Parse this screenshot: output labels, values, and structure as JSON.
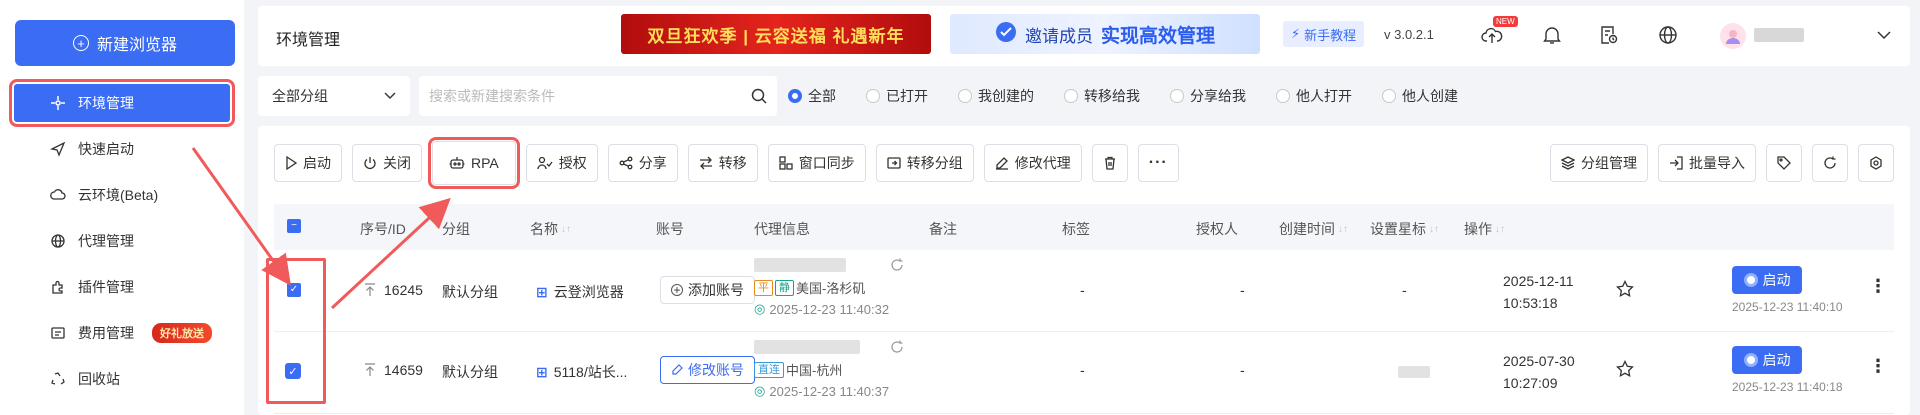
{
  "sidebar": {
    "new_button": "新建浏览器",
    "items": [
      {
        "label": "环境管理",
        "icon": "env-icon",
        "active": true
      },
      {
        "label": "快速启动",
        "icon": "send-icon"
      },
      {
        "label": "云环境(Beta)",
        "icon": "cloud-icon"
      },
      {
        "label": "代理管理",
        "icon": "globe-icon"
      },
      {
        "label": "插件管理",
        "icon": "plugin-icon"
      },
      {
        "label": "费用管理",
        "icon": "billing-icon",
        "badge": "好礼放送"
      },
      {
        "label": "回收站",
        "icon": "recycle-icon"
      }
    ]
  },
  "header": {
    "title": "环境管理",
    "banner1": "双旦狂欢季 | 云容送福 礼遇新年",
    "banner2_prefix": "邀请成员",
    "banner2_emphasis": "实现高效管理",
    "tutorial": "新手教程",
    "version": "v 3.0.2.1",
    "new_tag": "NEW"
  },
  "filters": {
    "group_select": "全部分组",
    "search_placeholder": "搜索或新建搜索条件",
    "radios": [
      "全部",
      "已打开",
      "我创建的",
      "转移给我",
      "分享给我",
      "他人打开",
      "他人创建"
    ],
    "selected_radio": 0
  },
  "toolbar": {
    "left": [
      {
        "label": "启动",
        "icon": "play-icon"
      },
      {
        "label": "关闭",
        "icon": "power-icon"
      },
      {
        "label": "RPA",
        "icon": "robot-icon"
      },
      {
        "label": "授权",
        "icon": "user-check-icon"
      },
      {
        "label": "分享",
        "icon": "share-icon"
      },
      {
        "label": "转移",
        "icon": "transfer-icon"
      },
      {
        "label": "窗口同步",
        "icon": "window-sync-icon"
      },
      {
        "label": "转移分组",
        "icon": "folder-move-icon"
      },
      {
        "label": "修改代理",
        "icon": "edit-icon"
      },
      {
        "label": "",
        "icon": "trash-icon"
      },
      {
        "label": "",
        "icon": "more-icon"
      }
    ],
    "right": [
      {
        "label": "分组管理",
        "icon": "layers-icon"
      },
      {
        "label": "批量导入",
        "icon": "import-icon"
      },
      {
        "label": "",
        "icon": "tag-icon"
      },
      {
        "label": "",
        "icon": "refresh-icon"
      },
      {
        "label": "",
        "icon": "settings-icon"
      }
    ]
  },
  "table": {
    "columns": {
      "id": "序号/ID",
      "group": "分组",
      "name": "名称",
      "account": "账号",
      "proxy": "代理信息",
      "remark": "备注",
      "tags": "标签",
      "authorized": "授权人",
      "created": "创建时间",
      "star": "设置星标",
      "ops": "操作"
    },
    "rows": [
      {
        "id": "16245",
        "group": "默认分组",
        "name": "云登浏览器",
        "account_btn": "添加账号",
        "proxy_tag1": "平",
        "proxy_tag2": "静",
        "proxy_location": "美国-洛杉矶",
        "proxy_checked": "2025-12-23 11:40:32",
        "remark": "-",
        "tags": "-",
        "authorized": "-",
        "created_date": "2025-12-11",
        "created_time": "10:53:18",
        "launch": "启动",
        "last_launch": "2025-12-23 11:40:10"
      },
      {
        "id": "14659",
        "group": "默认分组",
        "name": "5118/站长...",
        "account_btn": "修改账号",
        "proxy_tag1": "直连",
        "proxy_location": "中国-杭州",
        "proxy_checked": "2025-12-23 11:40:37",
        "remark": "-",
        "tags": "-",
        "authorized": "",
        "created_date": "2025-07-30",
        "created_time": "10:27:09",
        "launch": "启动",
        "last_launch": "2025-12-23 11:40:18"
      }
    ]
  },
  "colors": {
    "primary": "#3a6cf4",
    "highlight_red": "#f05a5a"
  }
}
